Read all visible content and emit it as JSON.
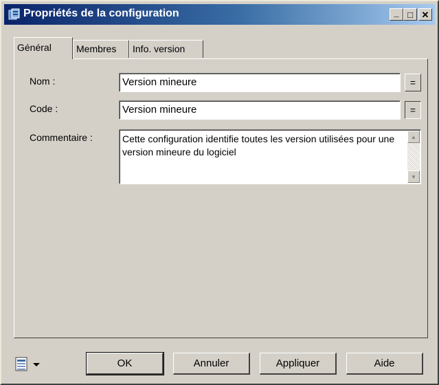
{
  "window": {
    "title": "Propriétés de la configuration",
    "icon": "config-properties-icon",
    "minimize_glyph": "_",
    "maximize_glyph": "□",
    "close_glyph": "✕"
  },
  "tabs": [
    {
      "label": "Général",
      "active": true
    },
    {
      "label": "Membres",
      "active": false
    },
    {
      "label": "Info. version",
      "active": false
    }
  ],
  "form": {
    "name_label": "Nom :",
    "name_value": "Version mineure",
    "code_label": "Code :",
    "code_value": "Version mineure",
    "comment_label": "Commentaire :",
    "comment_value": "Cette configuration identifie toutes les version utilisées pour une version mineure du logiciel",
    "eq_glyph": "="
  },
  "buttons": {
    "ok": "OK",
    "cancel": "Annuler",
    "apply": "Appliquer",
    "help": "Aide"
  },
  "colors": {
    "face": "#d4d0c8",
    "title_start": "#0a246a",
    "title_end": "#a6caf0"
  }
}
